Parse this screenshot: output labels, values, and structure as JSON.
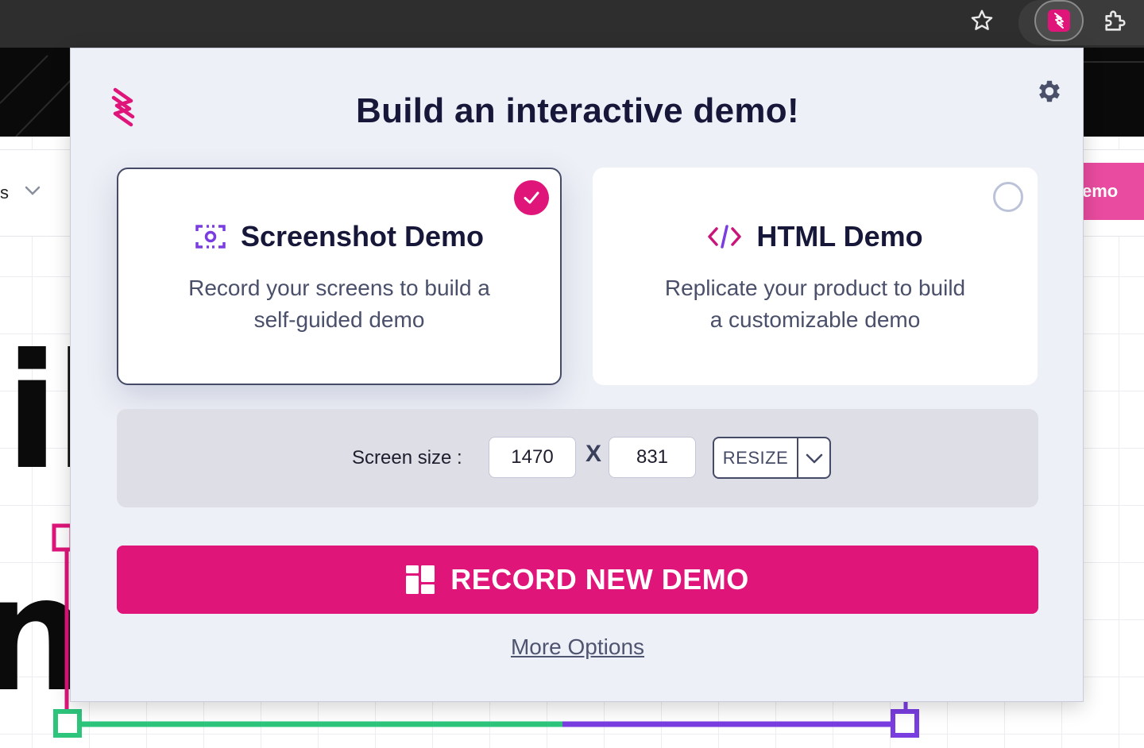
{
  "popup": {
    "title": "Build an interactive demo!",
    "options": [
      {
        "title": "Screenshot Demo",
        "description_line1": "Record your screens to build a",
        "description_line2": "self-guided demo",
        "selected": true
      },
      {
        "title": "HTML Demo",
        "description_line1": "Replicate your product to build",
        "description_line2": "a customizable demo",
        "selected": false
      }
    ],
    "screen_size": {
      "label": "Screen size :",
      "width": "1470",
      "separator": "X",
      "height": "831",
      "resize_label": "RESIZE"
    },
    "record_button": "RECORD NEW DEMO",
    "more_options": "More Options"
  },
  "background": {
    "nav_fragment": "s",
    "cta_fragment": "emo",
    "heading_fragment_1": "il",
    "heading_fragment_2": "n"
  },
  "colors": {
    "brand": "#e0157a",
    "title": "#17173a",
    "popup_bg": "#eef0f7",
    "panel_bg": "#dedfe6",
    "accent_purple": "#7a3de0",
    "accent_green": "#2dc57c"
  },
  "icons": {
    "star": "star-icon",
    "extension": "storylane-extension-icon",
    "puzzle": "puzzle-icon",
    "settings": "gear-icon",
    "screenshot": "screenshot-capture-icon",
    "html": "code-icon",
    "check": "check-icon",
    "record": "dashboard-grid-icon",
    "dropdown": "chevron-down-icon"
  }
}
